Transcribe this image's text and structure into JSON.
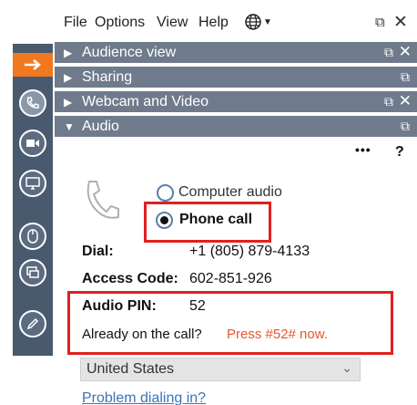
{
  "menu": {
    "file": "File",
    "options": "Options",
    "view": "View",
    "help": "Help"
  },
  "panels": {
    "audience_view": "Audience view",
    "sharing": "Sharing",
    "webcam": "Webcam and Video",
    "audio": "Audio"
  },
  "audio": {
    "more": "•••",
    "help": "?",
    "computer_audio": "Computer audio",
    "phone_call": "Phone call",
    "dial_label": "Dial:",
    "dial_value": "+1 (805) 879-4133",
    "access_code_label": "Access Code:",
    "access_code_value": "602-851-926",
    "pin_label": "Audio PIN:",
    "pin_value": "52",
    "already_on_call": "Already on the call?",
    "press_pin": "Press #52# now.",
    "country": "United States",
    "problem_link": "Problem dialing in?"
  },
  "colors": {
    "accent": "#f0781e",
    "panel_header": "#6f7b8c",
    "toolbar": "#4a5a6e",
    "highlight_box": "#e02020",
    "press_text": "#e8562a",
    "link": "#3b73b9"
  },
  "selected_audio_mode": "Phone call"
}
